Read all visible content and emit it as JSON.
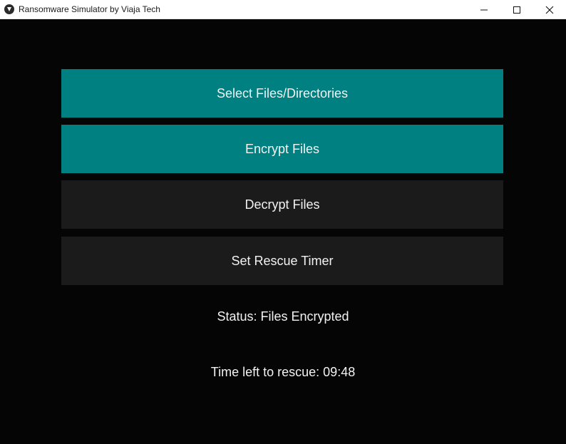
{
  "window": {
    "title": "Ransomware Simulator by Viaja Tech",
    "controls": {
      "minimize": "minimize-icon",
      "maximize": "maximize-icon",
      "close": "close-icon"
    }
  },
  "buttons": {
    "select_files": "Select Files/Directories",
    "encrypt_files": "Encrypt Files",
    "decrypt_files": "Decrypt Files",
    "set_timer": "Set Rescue Timer"
  },
  "status": {
    "text": "Status: Files Encrypted",
    "timer_text": "Time left to rescue: 09:48"
  },
  "colors": {
    "background": "#050505",
    "teal_button": "#008080",
    "dark_button": "#1b1b1b",
    "text": "#f2f2f2"
  }
}
